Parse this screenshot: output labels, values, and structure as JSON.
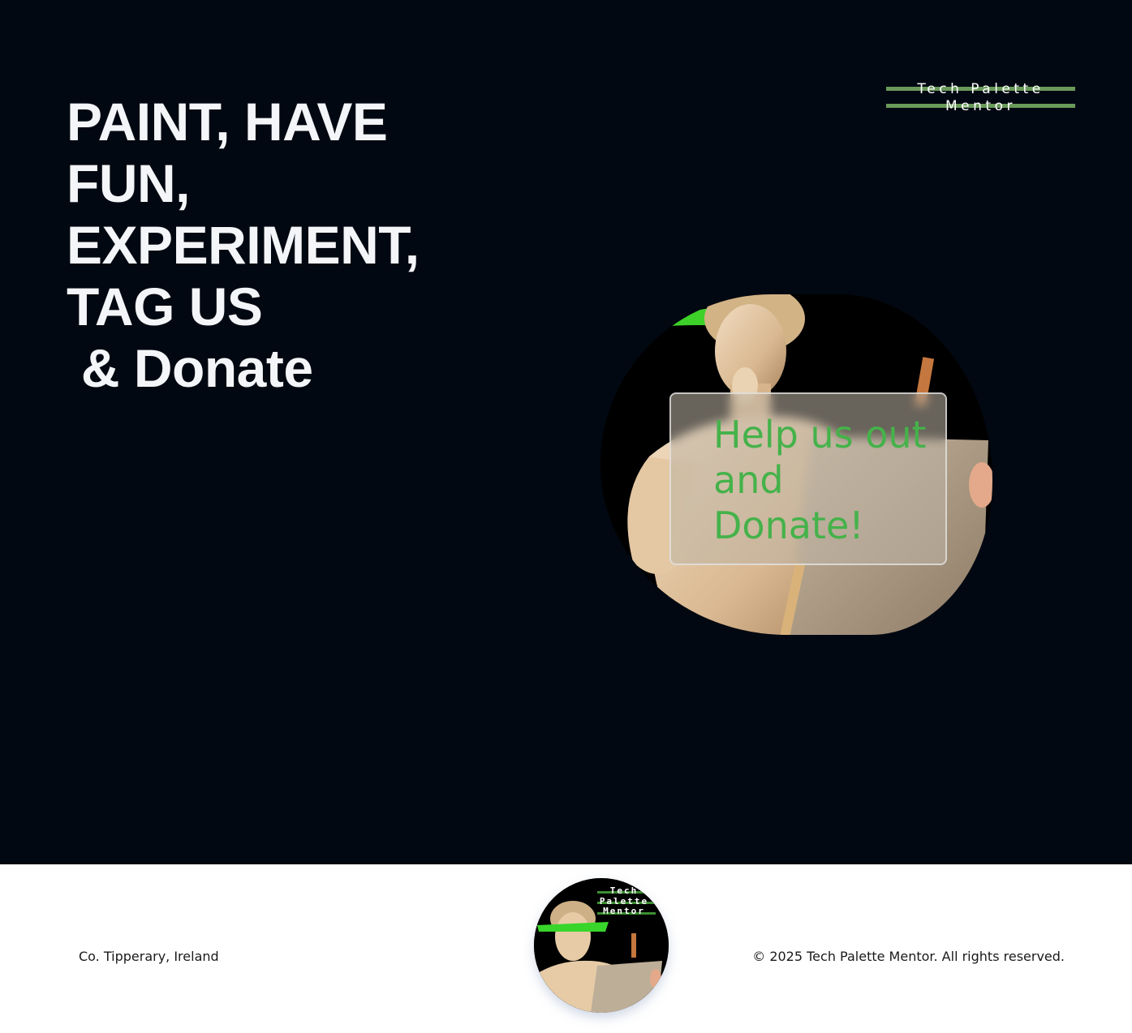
{
  "hero": {
    "headline_lines": [
      "PAINT, HAVE",
      "FUN,",
      "EXPERIMENT,",
      "TAG US",
      " & Donate"
    ],
    "brand_text": "Tech Palette Mentor",
    "cta_text": "Help us out and Donate!",
    "image": "statue-painting-canvas-image",
    "colors": {
      "background": "#020811",
      "accent": "#45b24a",
      "brand_bar": "#6a9a5a"
    }
  },
  "footer": {
    "location": "Co. Tipperary, Ireland",
    "copyright": "© 2025 Tech Palette Mentor. All rights reserved.",
    "logo_lines": [
      "Tech",
      "Palette",
      "Mentor"
    ]
  }
}
